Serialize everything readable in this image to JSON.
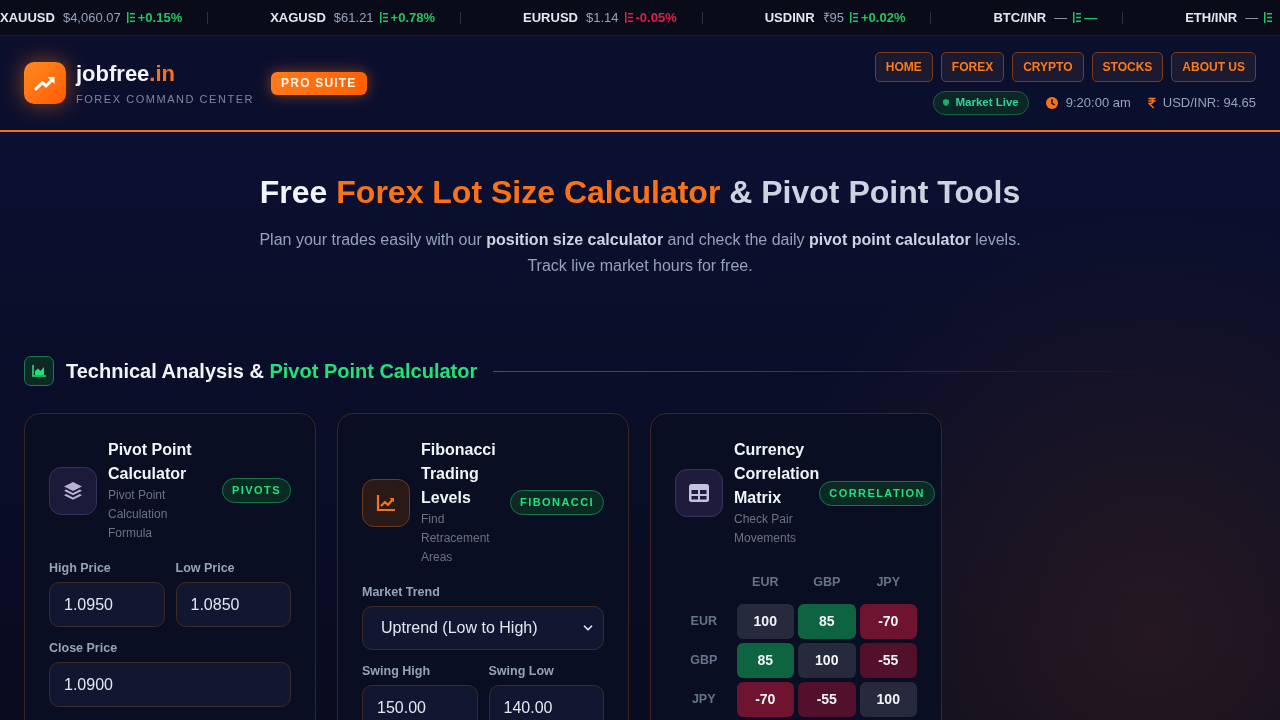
{
  "ticker": [
    {
      "symbol": "XAUUSD",
      "price": "$4,060.07",
      "color": "#22c55e",
      "change": "+0.15%"
    },
    {
      "symbol": "XAGUSD",
      "price": "$61.21",
      "color": "#22c55e",
      "change": "+0.78%"
    },
    {
      "symbol": "EURUSD",
      "price": "$1.14",
      "color": "#e11d48",
      "change": "-0.05%"
    },
    {
      "symbol": "USDINR",
      "price": "₹95",
      "color": "#22c55e",
      "change": "+0.02%"
    },
    {
      "symbol": "BTC/INR",
      "price": "—",
      "color": "#22c55e",
      "change": "—"
    },
    {
      "symbol": "ETH/INR",
      "price": "—",
      "color": "#22c55e"
    }
  ],
  "header": {
    "logo": {
      "name": "jobfree",
      "suffix": ".in",
      "tagline": "FOREX COMMAND CENTER"
    },
    "badge": "PRO SUITE",
    "nav": [
      {
        "label": "HOME"
      },
      {
        "label": "FOREX"
      },
      {
        "label": "CRYPTO"
      },
      {
        "label": "STOCKS"
      },
      {
        "label": "ABOUT US"
      }
    ],
    "status": {
      "market": "Market Live",
      "time": "9:20:00 am",
      "rate": "USD/INR: 94.65"
    }
  },
  "hero": {
    "title": {
      "before": "Free ",
      "highlight": "Forex Lot Size Calculator",
      "after": " & Pivot Point Tools"
    },
    "subtitle": "Plan your trades easily with our **position size calculator** and check the daily **pivot point calculator** levels. Track live market hours for free."
  },
  "section": {
    "title": {
      "text": "Technical Analysis & ",
      "highlight": "Pivot Point Calculator"
    }
  },
  "cards": [
    {
      "kind": "pivots",
      "title": "Pivot Point Calculator",
      "subtitle": "Pivot Point Calculation Formula",
      "badge": "PIVOTS",
      "rows": [
        [
          {
            "kind": "input",
            "label": "High Price",
            "value": "1.0950"
          },
          {
            "kind": "input",
            "label": "Low Price",
            "value": "1.0850"
          }
        ],
        [
          {
            "kind": "input",
            "label": "Close Price",
            "value": "1.0900"
          }
        ]
      ]
    },
    {
      "kind": "fibonacci",
      "title": "Fibonacci Trading Levels",
      "subtitle": "Find Retracement Areas",
      "badge": "FIBONACCI",
      "rows": [
        [
          {
            "kind": "select",
            "label": "Market Trend",
            "value": "Uptrend (Low to High)"
          }
        ],
        [
          {
            "kind": "input",
            "label": "Swing High",
            "value": "150.00"
          },
          {
            "kind": "input",
            "label": "Swing Low",
            "value": "140.00"
          }
        ]
      ]
    },
    {
      "kind": "correlation",
      "title": "Currency Correlation Matrix",
      "subtitle": "Check Pair Movements",
      "badge": "CORRELATION",
      "matrix": {
        "columns": [
          "EUR",
          "GBP",
          "JPY"
        ],
        "rows": [
          {
            "label": "EUR",
            "cells": [
              {
                "value": "100",
                "color": "#262a3c"
              },
              {
                "value": "85",
                "color": "#0e6441"
              },
              {
                "value": "-70",
                "color": "#6e1330"
              }
            ]
          },
          {
            "label": "GBP",
            "cells": [
              {
                "value": "85",
                "color": "#0e6441"
              },
              {
                "value": "100",
                "color": "#262a3c"
              },
              {
                "value": "-55",
                "color": "#52102a"
              }
            ]
          },
          {
            "label": "JPY",
            "cells": [
              {
                "value": "-70",
                "color": "#6e1330"
              },
              {
                "value": "-55",
                "color": "#52102a"
              },
              {
                "value": "100",
                "color": "#262a3c"
              }
            ]
          }
        ]
      }
    }
  ]
}
